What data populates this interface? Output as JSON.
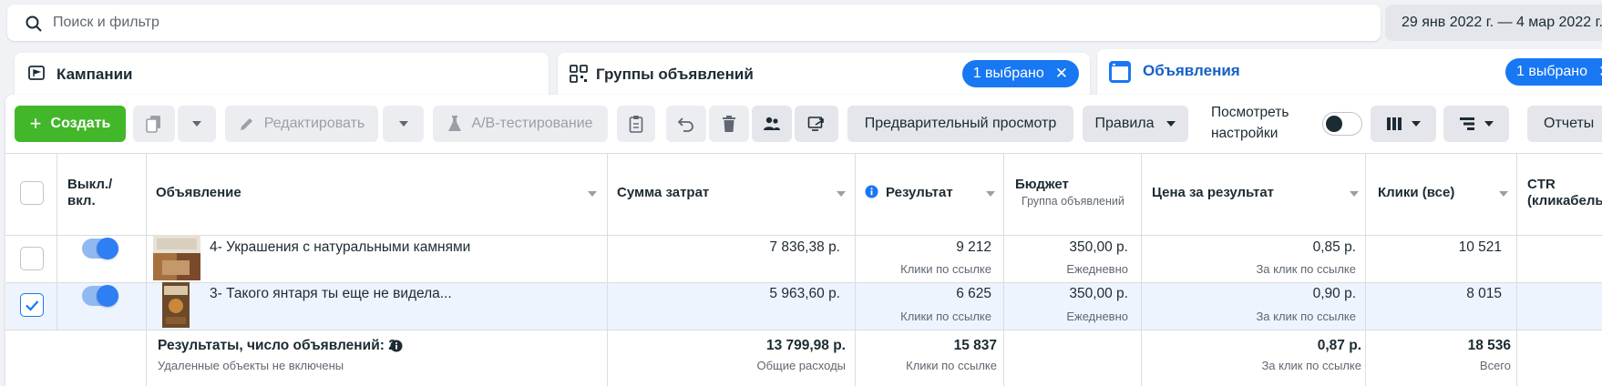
{
  "search": {
    "placeholder": "Поиск и фильтр"
  },
  "date_range": "29 янв 2022 г. — 4 мар 2022 г.",
  "tabs": {
    "campaigns": {
      "label": "Кампании"
    },
    "adsets": {
      "label": "Группы объявлений",
      "chip": "1 выбрано"
    },
    "ads": {
      "label": "Объявления",
      "chip": "1 выбрано"
    }
  },
  "toolbar": {
    "create": "Создать",
    "edit": "Редактировать",
    "ab_test": "A/B-тестирование",
    "preview": "Предварительный просмотр",
    "rules": "Правила",
    "view_settings_line1": "Посмотреть",
    "view_settings_line2": "настройки",
    "reports": "Отчеты"
  },
  "table": {
    "headers": {
      "onoff_line1": "Выкл./",
      "onoff_line2": "вкл.",
      "ad": "Объявление",
      "spend": "Сумма затрат",
      "result": "Результат",
      "budget": "Бюджет",
      "budget_sub": "Группа объявлений",
      "cost_per_result": "Цена за результат",
      "clicks_all": "Клики (все)",
      "ctr_line1": "CTR",
      "ctr_line2": "(кликабель"
    },
    "rows": [
      {
        "name": "4- Украшения с натуральными камнями",
        "spend": "7 836,38 р.",
        "result": "9 212",
        "result_sub": "Клики по ссылке",
        "budget": "350,00 р.",
        "budget_sub": "Ежедневно",
        "cost": "0,85 р.",
        "cost_sub": "За клик по ссылке",
        "clicks": "10 521",
        "selected": false
      },
      {
        "name": "3- Такого янтаря ты еще не видела...",
        "spend": "5 963,60 р.",
        "result": "6 625",
        "result_sub": "Клики по ссылке",
        "budget": "350,00 р.",
        "budget_sub": "Ежедневно",
        "cost": "0,90 р.",
        "cost_sub": "За клик по ссылке",
        "clicks": "8 015",
        "selected": true
      }
    ],
    "totals": {
      "label": "Результаты, число объявлений: 2",
      "note": "Удаленные объекты не включены",
      "spend": "13 799,98 р.",
      "spend_sub": "Общие расходы",
      "result": "15 837",
      "result_sub": "Клики по ссылке",
      "cost": "0,87 р.",
      "cost_sub": "За клик по ссылке",
      "clicks": "18 536",
      "clicks_sub": "Всего"
    }
  },
  "colors": {
    "accent": "#1877f2",
    "create_green": "#42b72a",
    "selected_row": "#eef4fd"
  }
}
